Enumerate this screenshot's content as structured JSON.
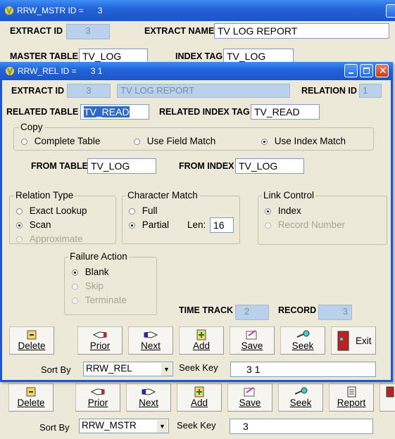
{
  "back_window": {
    "title": "RRW_MSTR ID =      3",
    "extract_id_label": "EXTRACT ID",
    "extract_id_value": "3",
    "extract_name_label": "EXTRACT NAME",
    "extract_name_value": "TV LOG REPORT",
    "master_table_label": "MASTER TABLE",
    "master_table_value": "TV_LOG",
    "index_tag_label": "INDEX TAG",
    "index_tag_value": "TV_LOG",
    "buttons": {
      "delete": "Delete",
      "prior": "Prior",
      "next": "Next",
      "add": "Add",
      "save": "Save",
      "seek": "Seek",
      "report": "Report"
    },
    "sort_by_label": "Sort By",
    "sort_by_value": "RRW_MSTR",
    "seek_key_label": "Seek Key",
    "seek_key_value": "3"
  },
  "front_window": {
    "title": "RRW_REL ID =      3 1",
    "extract_id_label": "EXTRACT ID",
    "extract_id_value": "3",
    "extract_name_value": "TV LOG REPORT",
    "relation_id_label": "RELATION ID",
    "relation_id_value": "1",
    "related_table_label": "RELATED TABLE",
    "related_table_value": "TV_READ",
    "related_index_tag_label": "RELATED INDEX TAG",
    "related_index_tag_value": "TV_READ",
    "copy": {
      "legend": "Copy",
      "options": [
        "Complete Table",
        "Use Field Match",
        "Use Index Match"
      ],
      "selected": "Use Index Match"
    },
    "from_table_label": "FROM TABLE",
    "from_table_value": "TV_LOG",
    "from_index_label": "FROM INDEX",
    "from_index_value": "TV_LOG",
    "relation_type": {
      "legend": "Relation Type",
      "options": [
        "Exact Lookup",
        "Scan",
        "Approximate"
      ],
      "selected": "Scan"
    },
    "character_match": {
      "legend": "Character Match",
      "options": [
        "Full",
        "Partial"
      ],
      "selected": "Partial",
      "len_label": "Len:",
      "len_value": "16"
    },
    "link_control": {
      "legend": "Link Control",
      "options": [
        "Index",
        "Record Number"
      ],
      "selected": "Index"
    },
    "failure_action": {
      "legend": "Failure Action",
      "options": [
        "Blank",
        "Skip",
        "Terminate"
      ],
      "selected": "Blank"
    },
    "time_track_label": "TIME TRACK",
    "time_track_value": "2",
    "record_label": "RECORD",
    "record_value": "3",
    "buttons": {
      "delete": "Delete",
      "prior": "Prior",
      "next": "Next",
      "add": "Add",
      "save": "Save",
      "seek": "Seek",
      "exit": "Exit"
    },
    "sort_by_label": "Sort By",
    "sort_by_value": "RRW_REL",
    "seek_key_label": "Seek Key",
    "seek_key_value": "3 1"
  },
  "colors": {
    "titlebar": "#2463d8",
    "window_bg": "#ece9d8",
    "disabled_field": "#b9d1ea"
  }
}
